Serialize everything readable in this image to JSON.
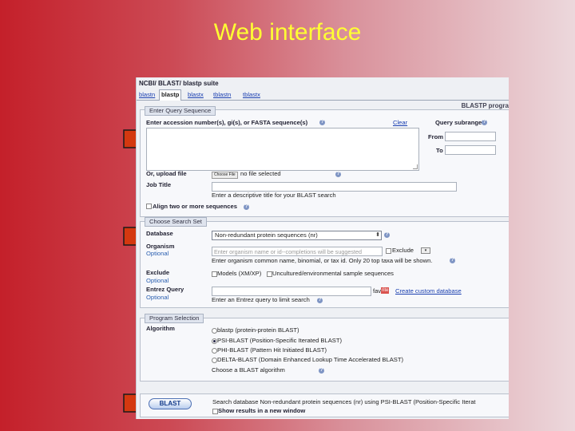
{
  "slide": {
    "title": "Web interface"
  },
  "blast": {
    "breadcrumb": "NCBI/ BLAST/ blastp suite",
    "tabs": [
      "blastn",
      "blastp",
      "blastx",
      "tblastn",
      "tblastx"
    ],
    "page_heading": "BLASTP progra",
    "query": {
      "legend": "Enter Query Sequence",
      "accession_label": "Enter accession number(s), gi(s), or FASTA sequence(s)",
      "clear_link": "Clear",
      "subrange_label": "Query subrange",
      "from_label": "From",
      "to_label": "To",
      "upload_label": "Or, upload file",
      "choose_file_button": "Choose File",
      "no_file_text": "no file selected",
      "job_title_label": "Job Title",
      "job_title_hint": "Enter a descriptive title for your BLAST search",
      "align_label": "Align two or more sequences"
    },
    "search_set": {
      "legend": "Choose Search Set",
      "database_label": "Database",
      "database_value": "Non-redundant protein sequences (nr)",
      "organism_label": "Organism",
      "optional": "Optional",
      "organism_placeholder": "Enter organism name or id--completions will be suggested",
      "exclude_small": "Exclude",
      "organism_hint": "Enter organism common name, binomial, or tax id. Only 20 top taxa will be shown.",
      "exclude_label": "Exclude",
      "models_option": "Models (XM/XP)",
      "uncultured_option": "Uncultured/environmental sample sequences",
      "entrez_label": "Entrez Query",
      "entrez_hint": "Enter an Entrez query to limit search",
      "fav_text": "fav",
      "badge": "rite",
      "custom_db_link": "Create custom database"
    },
    "program": {
      "legend": "Program Selection",
      "algorithm_label": "Algorithm",
      "algorithms": [
        {
          "label": "blastp (protein-protein BLAST)",
          "selected": false
        },
        {
          "label": "PSI-BLAST (Position-Specific Iterated BLAST)",
          "selected": true
        },
        {
          "label": "PHI-BLAST (Pattern Hit Initiated BLAST)",
          "selected": false
        },
        {
          "label": "DELTA-BLAST (Domain Enhanced Lookup Time Accelerated BLAST)",
          "selected": false
        }
      ],
      "choose_text": "Choose a BLAST algorithm"
    },
    "submit": {
      "button_label": "BLAST",
      "summary": "Search database Non-redundant protein sequences (nr) using PSI-BLAST (Position-Specific Iterat",
      "new_window_label": "Show results in a new window"
    }
  },
  "colors": {
    "arrow_fill": "#d4380f",
    "arrow_stroke": "#1a1a1a",
    "title": "#ffff33"
  }
}
